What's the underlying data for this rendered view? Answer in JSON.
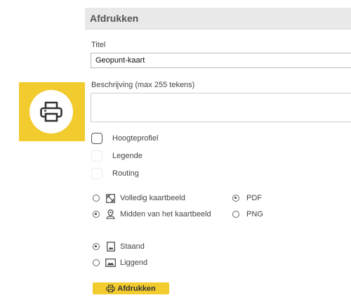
{
  "panel": {
    "title": "Afdrukken",
    "title_field_label": "Titel",
    "title_value": "Geopunt-kaart",
    "description_label": "Beschrijving (max 255 tekens)",
    "description_value": ""
  },
  "checkboxes": [
    {
      "label": "Hoogteprofiel",
      "checked": false
    },
    {
      "label": "Legende",
      "checked": false
    },
    {
      "label": "Routing",
      "checked": false
    }
  ],
  "extent_options": [
    {
      "label": "Volledig kaartbeeld",
      "icon": "full-extent-icon",
      "selected": false
    },
    {
      "label": "Midden van het kaartbeeld",
      "icon": "map-pin-icon",
      "selected": true
    }
  ],
  "format_options": [
    {
      "label": "PDF",
      "selected": true
    },
    {
      "label": "PNG",
      "selected": false
    }
  ],
  "orientation_options": [
    {
      "label": "Staand",
      "icon": "portrait-icon",
      "selected": true
    },
    {
      "label": "Liggend",
      "icon": "landscape-icon",
      "selected": false
    }
  ],
  "print_button": {
    "label": "Afdrukken",
    "icon": "printer-icon"
  },
  "tool_button": {
    "icon": "printer-icon"
  },
  "colors": {
    "accent": "#f2cb2f",
    "header_bg": "#e9e9e9"
  }
}
